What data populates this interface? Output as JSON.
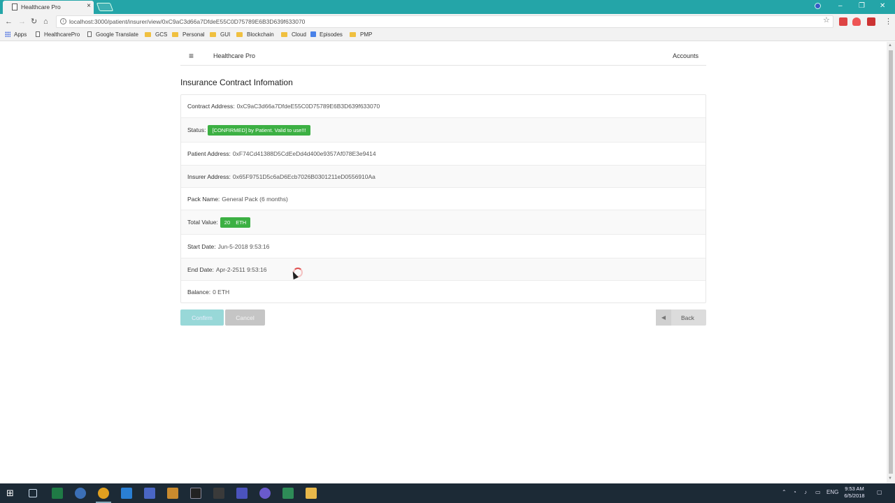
{
  "browser": {
    "tab_title": "Healthcare Pro",
    "tab_close": "×",
    "url": "localhost:3000/patient/insurer/view/0xC9aC3d66a7DfdeE55C0D75789E6B3D639f633070",
    "info_glyph": "i",
    "bookmarks": [
      "Apps",
      "HealthcarePro",
      "Google Translate",
      "GCS",
      "Personal",
      "GUI",
      "Blockchain",
      "Cloud",
      "Episodes",
      "PMP"
    ],
    "colors": {
      "titlebar": "#24a5a8"
    }
  },
  "app": {
    "menu_glyph": "≡",
    "brand": "Healthcare Pro",
    "accounts_link": "Accounts",
    "page_title": "Insurance Contract Infomation"
  },
  "contract": {
    "address_label": "Contract Address:",
    "address_value": "0xC9aC3d66a7DfdeE55C0D75789E6B3D639f633070",
    "status_label": "Status:",
    "status_value": "[CONFIRMED] by Patient. Valid to use!!!",
    "patient_label": "Patient Address:",
    "patient_value": "0xF74Cd41388D5CdEeDd4d400e9357Af078E3e9414",
    "insurer_label": "Insurer Address:",
    "insurer_value": "0x65F9751D5c6aD6Ecb7026B0301211eD0556910Aa",
    "pack_label": "Pack Name:",
    "pack_value": "General Pack (6 months)",
    "total_label": "Total Value:",
    "total_value": "20  ETH",
    "start_label": "Start Date:",
    "start_value": "Jun-5-2018 9:53:16",
    "end_label": "End Date:",
    "end_value": "Apr-2-2511 9:53:16",
    "balance_label": "Balance:",
    "balance_value": "0 ETH"
  },
  "actions": {
    "confirm": "Confirm",
    "cancel": "Cancel",
    "back": "Back"
  },
  "taskbar": {
    "lang": "ENG",
    "time": "9:53 AM",
    "date": "6/5/2018"
  },
  "colors": {
    "status_green": "#3cb043",
    "confirm_disabled": "#98d8d8",
    "cancel_disabled": "#c5c5c5"
  }
}
